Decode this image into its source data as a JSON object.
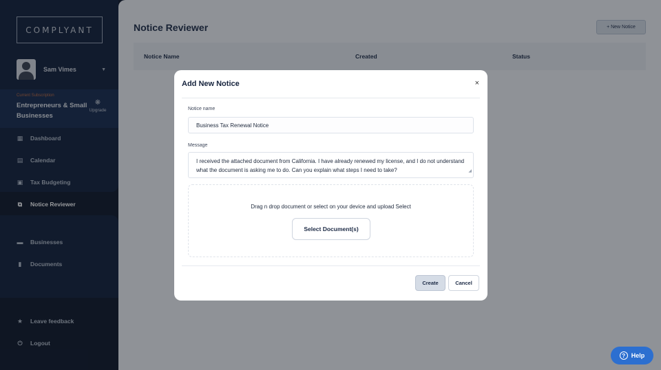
{
  "sidebar": {
    "logo": "COMPLYANT",
    "user_name": "Sam Vimes",
    "plan_label": "Current Subscription",
    "plan_name": "Entrepreneurs & Small Businesses",
    "upgrade_label": "Upgrade",
    "nav_top": [
      {
        "label": "Dashboard",
        "icon": "dashboard-icon"
      },
      {
        "label": "Calendar",
        "icon": "calendar-icon"
      },
      {
        "label": "Tax Budgeting",
        "icon": "tax-budgeting-icon"
      }
    ],
    "active_item": {
      "label": "Notice Reviewer",
      "icon": "notice-reviewer-icon"
    },
    "nav_mid": [
      {
        "label": "Businesses",
        "icon": "briefcase-icon"
      },
      {
        "label": "Documents",
        "icon": "document-icon"
      }
    ],
    "nav_bottom": [
      {
        "label": "Leave feedback",
        "icon": "star-icon"
      },
      {
        "label": "Logout",
        "icon": "power-icon"
      }
    ]
  },
  "main": {
    "title": "Notice Reviewer",
    "new_button": "+ New Notice",
    "columns": [
      "Notice Name",
      "Created",
      "Status"
    ]
  },
  "modal": {
    "title": "Add New Notice",
    "close_glyph": "×",
    "name_label": "Notice name",
    "name_value": "Business Tax Renewal Notice",
    "message_label": "Message",
    "message_value": "I received the attached document from California. I have already renewed my license, and I do not understand what the document is asking me to do. Can you explain what steps I need to take?",
    "dropzone_text": "Drag n drop document or select on your device and upload Select",
    "select_button": "Select Document(s)",
    "create_button": "Create",
    "cancel_button": "Cancel"
  },
  "help": {
    "label": "Help"
  },
  "colors": {
    "sidebar_bg": "#0f1e3a",
    "accent": "#2c6fd0",
    "overlay": "rgba(20,24,32,0.45)"
  }
}
